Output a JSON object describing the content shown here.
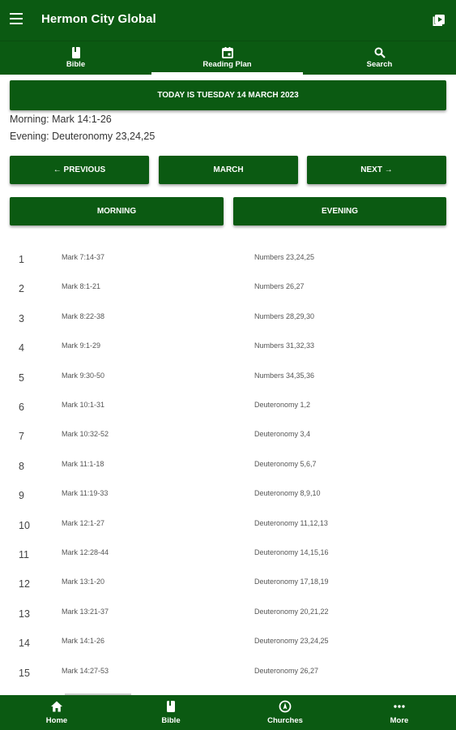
{
  "app": {
    "title": "Hermon City Global"
  },
  "tabs": [
    {
      "label": "Bible",
      "icon": "book-icon"
    },
    {
      "label": "Reading Plan",
      "icon": "calendar-icon",
      "active": true
    },
    {
      "label": "Search",
      "icon": "search-icon"
    }
  ],
  "today_banner": "TODAY IS TUESDAY 14 MARCH 2023",
  "today": {
    "morning": "Morning: Mark 14:1-26",
    "evening": "Evening: Deuteronomy 23,24,25"
  },
  "nav_buttons": {
    "previous": "← PREVIOUS",
    "month": "MARCH",
    "next": "NEXT →"
  },
  "session_buttons": {
    "morning": "MORNING",
    "evening": "EVENING"
  },
  "plan": [
    {
      "day": "1",
      "morning": "Mark 7:14-37",
      "evening": "Numbers 23,24,25"
    },
    {
      "day": "2",
      "morning": "Mark 8:1-21",
      "evening": "Numbers 26,27"
    },
    {
      "day": "3",
      "morning": "Mark 8:22-38",
      "evening": "Numbers 28,29,30"
    },
    {
      "day": "4",
      "morning": "Mark 9:1-29",
      "evening": "Numbers 31,32,33"
    },
    {
      "day": "5",
      "morning": "Mark 9:30-50",
      "evening": "Numbers 34,35,36"
    },
    {
      "day": "6",
      "morning": "Mark 10:1-31",
      "evening": "Deuteronomy 1,2"
    },
    {
      "day": "7",
      "morning": "Mark 10:32-52",
      "evening": "Deuteronomy 3,4"
    },
    {
      "day": "8",
      "morning": "Mark 11:1-18",
      "evening": "Deuteronomy 5,6,7"
    },
    {
      "day": "9",
      "morning": "Mark 11:19-33",
      "evening": "Deuteronomy 8,9,10"
    },
    {
      "day": "10",
      "morning": "Mark 12:1-27",
      "evening": "Deuteronomy 11,12,13"
    },
    {
      "day": "11",
      "morning": "Mark 12:28-44",
      "evening": "Deuteronomy 14,15,16"
    },
    {
      "day": "12",
      "morning": "Mark 13:1-20",
      "evening": "Deuteronomy 17,18,19"
    },
    {
      "day": "13",
      "morning": "Mark 13:21-37",
      "evening": "Deuteronomy 20,21,22"
    },
    {
      "day": "14",
      "morning": "Mark 14:1-26",
      "evening": "Deuteronomy 23,24,25"
    },
    {
      "day": "15",
      "morning": "Mark 14:27-53",
      "evening": "Deuteronomy 26,27"
    }
  ],
  "bottom_nav": [
    {
      "label": "Home",
      "icon": "home-icon"
    },
    {
      "label": "Bible",
      "icon": "book-icon"
    },
    {
      "label": "Churches",
      "icon": "compass-icon"
    },
    {
      "label": "More",
      "icon": "more-icon"
    }
  ],
  "colors": {
    "primary": "#0b5a12",
    "on_primary": "#ffffff",
    "text": "#333333"
  }
}
